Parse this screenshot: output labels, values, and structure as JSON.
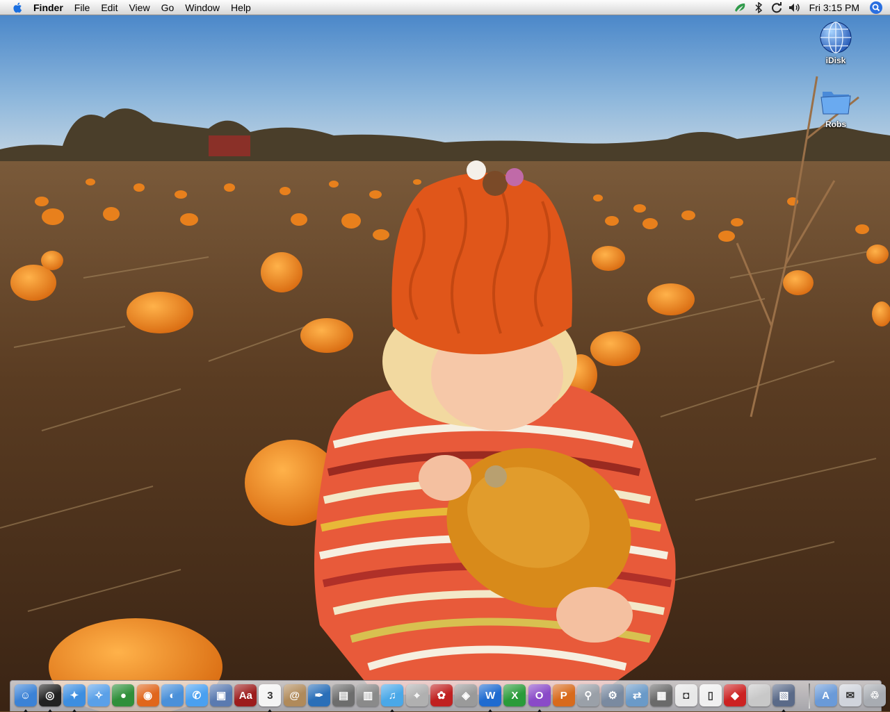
{
  "menubar": {
    "app_name": "Finder",
    "menus": [
      "File",
      "Edit",
      "View",
      "Go",
      "Window",
      "Help"
    ],
    "clock": "Fri 3:15 PM"
  },
  "desktop_icons": [
    {
      "label": "iDisk",
      "icon": "idisk-globe-icon"
    },
    {
      "label": "Robs",
      "icon": "folder-icon"
    }
  ],
  "dock": {
    "apps": [
      {
        "name": "Finder",
        "icon": "finder-icon",
        "color": "#3b82d6",
        "glyph": "☺",
        "running": true
      },
      {
        "name": "Dashboard",
        "icon": "dashboard-icon",
        "color": "#222222",
        "glyph": "◎",
        "running": true
      },
      {
        "name": "Safari",
        "icon": "safari-icon",
        "color": "#3d8ee0",
        "glyph": "✦",
        "running": true
      },
      {
        "name": "Network Utility",
        "icon": "network-icon",
        "color": "#5aa0e8",
        "glyph": "✧",
        "running": false
      },
      {
        "name": "Internet Connect",
        "icon": "globe-icon",
        "color": "#2f8f3a",
        "glyph": "●",
        "running": false
      },
      {
        "name": "Firefox",
        "icon": "firefox-icon",
        "color": "#e0661c",
        "glyph": "◉",
        "running": false
      },
      {
        "name": "Camino",
        "icon": "camino-icon",
        "color": "#4a90d9",
        "glyph": "◐",
        "running": false
      },
      {
        "name": "iChat",
        "icon": "ichat-icon",
        "color": "#4aa0f0",
        "glyph": "✆",
        "running": false
      },
      {
        "name": "Preview",
        "icon": "preview-icon",
        "color": "#5a7ab0",
        "glyph": "▣",
        "running": false
      },
      {
        "name": "Dictionary",
        "icon": "dictionary-icon",
        "color": "#9c1c1c",
        "glyph": "Aa",
        "running": false
      },
      {
        "name": "iCal",
        "icon": "ical-icon",
        "color": "#f4f4f4",
        "glyph": "3",
        "running": true
      },
      {
        "name": "Address Book",
        "icon": "address-book-icon",
        "color": "#b08a5a",
        "glyph": "@",
        "running": false
      },
      {
        "name": "Pages",
        "icon": "pen-icon",
        "color": "#2a6fb8",
        "glyph": "✒",
        "running": false
      },
      {
        "name": "iPhoto",
        "icon": "iphoto-icon",
        "color": "#6d6d6d",
        "glyph": "▤",
        "running": false
      },
      {
        "name": "Image Capture",
        "icon": "image-capture-icon",
        "color": "#8a8a8a",
        "glyph": "▥",
        "running": false
      },
      {
        "name": "iTunes",
        "icon": "itunes-icon",
        "color": "#4aa8e8",
        "glyph": "♫",
        "running": true
      },
      {
        "name": "Telescope",
        "icon": "telescope-icon",
        "color": "#b0b0b0",
        "glyph": "⌖",
        "running": false
      },
      {
        "name": "Front Row",
        "icon": "popcorn-icon",
        "color": "#c02020",
        "glyph": "✿",
        "running": false
      },
      {
        "name": "Stuffit",
        "icon": "stuffit-icon",
        "color": "#9a9a9a",
        "glyph": "◈",
        "running": false
      },
      {
        "name": "Word",
        "icon": "word-icon",
        "color": "#1f6bd0",
        "glyph": "W",
        "running": true
      },
      {
        "name": "Excel",
        "icon": "excel-icon",
        "color": "#2a9b3a",
        "glyph": "X",
        "running": false
      },
      {
        "name": "Entourage",
        "icon": "entourage-icon",
        "color": "#8a4ac8",
        "glyph": "O",
        "running": true
      },
      {
        "name": "PowerPoint",
        "icon": "powerpoint-icon",
        "color": "#d86a1c",
        "glyph": "P",
        "running": false
      },
      {
        "name": "Grab",
        "icon": "magnifier-icon",
        "color": "#9aa0a8",
        "glyph": "⚲",
        "running": false
      },
      {
        "name": "Automator",
        "icon": "automator-icon",
        "color": "#7a8aa0",
        "glyph": "⚙",
        "running": false
      },
      {
        "name": "Migration Assistant",
        "icon": "migration-icon",
        "color": "#6a9ac8",
        "glyph": "⇄",
        "running": false
      },
      {
        "name": "Calculator",
        "icon": "calculator-icon",
        "color": "#6a6a6a",
        "glyph": "▦",
        "running": false
      },
      {
        "name": "iPod",
        "icon": "ipod-icon",
        "color": "#e8e8e8",
        "glyph": "◘",
        "running": false
      },
      {
        "name": "Flashcards",
        "icon": "cards-icon",
        "color": "#f0f0f0",
        "glyph": "▯",
        "running": false
      },
      {
        "name": "Microsoft Office",
        "icon": "office-icon",
        "color": "#cc2222",
        "glyph": "◆",
        "running": false
      },
      {
        "name": "System Profiler",
        "icon": "apple-icon",
        "color": "#c8c8c8",
        "glyph": "",
        "running": false
      },
      {
        "name": "Keynote",
        "icon": "keynote-icon",
        "color": "#5a6a88",
        "glyph": "▧",
        "running": true
      }
    ],
    "stacks": [
      {
        "name": "Applications",
        "icon": "applications-folder-icon",
        "color": "#6a9ad8",
        "glyph": "A"
      },
      {
        "name": "Mail",
        "icon": "mail-icon",
        "color": "#d0d4dc",
        "glyph": "✉"
      },
      {
        "name": "Trash",
        "icon": "trash-icon",
        "color": "#a8acb2",
        "glyph": "♲"
      }
    ]
  }
}
